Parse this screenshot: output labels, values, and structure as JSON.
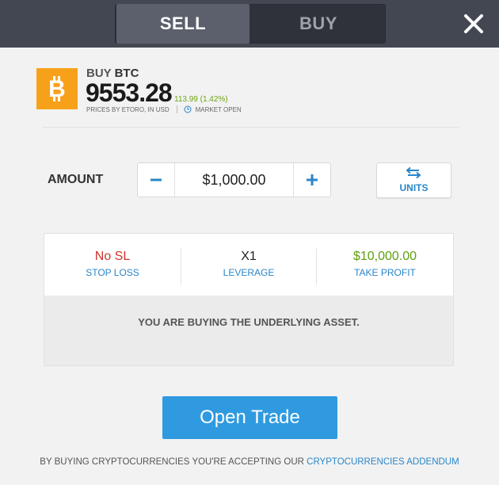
{
  "tabs": {
    "sell": "SELL",
    "buy": "BUY",
    "active": "sell"
  },
  "instrument": {
    "action": "BUY",
    "symbol": "BTC",
    "price": "9553.28",
    "change": "113.99 (1.42%)",
    "source": "PRICES BY ETORO, IN USD",
    "market_status": "MARKET OPEN"
  },
  "amount": {
    "label": "AMOUNT",
    "value": "$1,000.00",
    "units_label": "UNITS"
  },
  "order": {
    "stop_loss": {
      "value": "No SL",
      "label": "STOP LOSS"
    },
    "leverage": {
      "value": "X1",
      "label": "LEVERAGE"
    },
    "take_profit": {
      "value": "$10,000.00",
      "label": "TAKE PROFIT"
    },
    "message": "YOU ARE BUYING THE UNDERLYING ASSET."
  },
  "open_trade_label": "Open Trade",
  "footer": {
    "text": "BY BUYING CRYPTOCURRENCIES YOU'RE ACCEPTING OUR ",
    "link": "CRYPTOCURRENCIES ADDENDUM"
  },
  "icons": {
    "close": "close-icon",
    "bitcoin": "bitcoin-icon",
    "clock": "clock-icon",
    "minus": "minus-icon",
    "plus": "plus-icon",
    "swap": "swap-arrows-icon"
  },
  "colors": {
    "accent": "#2a86c9",
    "button": "#2f9ae0",
    "loss": "#d0342c",
    "profit": "#5e9e0f",
    "bitcoin": "#f7a11a"
  }
}
